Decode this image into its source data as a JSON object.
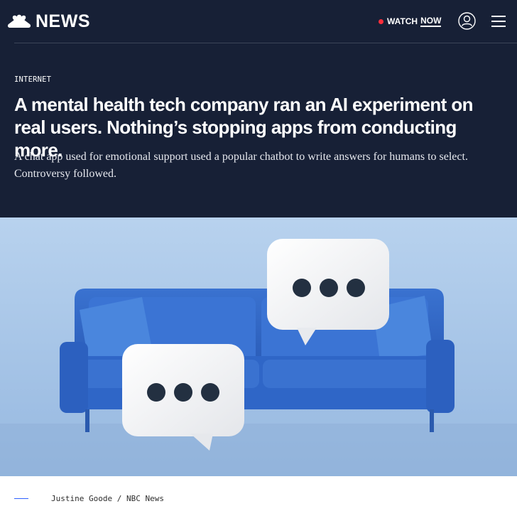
{
  "header": {
    "logo_text": "NEWS",
    "watch_label": "WATCH",
    "watch_now_label": "NOW",
    "live_color": "#ff2e3b",
    "account_icon": "user-circle-icon",
    "menu_icon": "hamburger-menu-icon"
  },
  "article": {
    "section": "INTERNET",
    "headline": "A mental health tech company ran an AI experiment on real users. Nothing’s stopping apps from conducting more.",
    "dek": "A chat app used for emotional support used a popular chatbot to write answers for humans to select. Controversy followed."
  },
  "image": {
    "description_icon": "couch-with-speech-bubbles-illustration",
    "credit": "Justine Goode / NBC News"
  },
  "colors": {
    "header_bg": "#172036",
    "accent_rule": "#3061ff",
    "sofa_blue": "#2f66c7",
    "backdrop_blue": "#a9c6e8"
  }
}
